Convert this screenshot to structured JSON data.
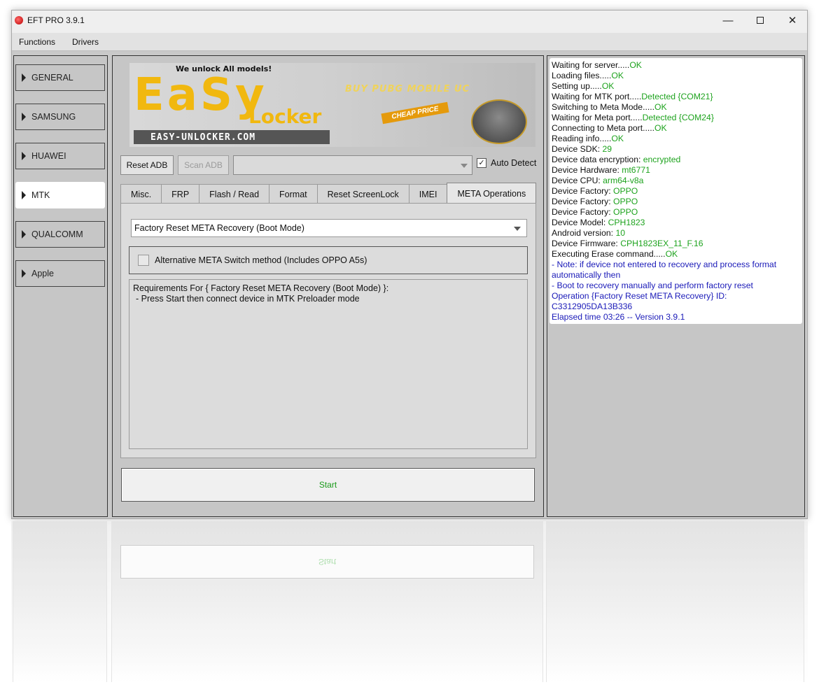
{
  "window": {
    "title": "EFT PRO 3.9.1",
    "controls": {
      "minimize": "—",
      "maximize": "",
      "close": "✕"
    }
  },
  "menu": {
    "items": [
      "Functions",
      "Drivers"
    ]
  },
  "sidebar": {
    "items": [
      {
        "label": "GENERAL",
        "active": false
      },
      {
        "label": "SAMSUNG",
        "active": false
      },
      {
        "label": "HUAWEI",
        "active": false
      },
      {
        "label": "MTK",
        "active": true
      },
      {
        "label": "QUALCOMM",
        "active": false
      },
      {
        "label": "Apple",
        "active": false
      }
    ]
  },
  "banner": {
    "tagline": "We unlock All models!",
    "logo_main": "EaSy",
    "logo_sub": "Locker",
    "site": "EASY-UNLOCKER.COM",
    "promo": "BUY PUBG MOBILE UC",
    "price_tag": "CHEAP PRICE",
    "badge_icon": "pubg-badge-icon"
  },
  "toolbar": {
    "reset_adb": "Reset ADB",
    "scan_adb": "Scan ADB",
    "port_select_value": "",
    "auto_detect_label": "Auto Detect",
    "auto_detect_checked": true
  },
  "tabs": [
    {
      "label": "Misc.",
      "active": false
    },
    {
      "label": "FRP",
      "active": false
    },
    {
      "label": "Flash / Read",
      "active": false
    },
    {
      "label": "Format",
      "active": false
    },
    {
      "label": "Reset ScreenLock",
      "active": false
    },
    {
      "label": "IMEI",
      "active": false
    },
    {
      "label": "META Operations",
      "active": true
    }
  ],
  "meta_ops": {
    "operation_value": "Factory Reset META Recovery (Boot Mode)",
    "alt_switch_label": "Alternative META Switch method (Includes OPPO A5s)",
    "alt_switch_checked": false,
    "requirements_line1": "Requirements For { Factory Reset META Recovery (Boot Mode) }:",
    "requirements_line2": "- Press Start then connect device in MTK Preloader mode"
  },
  "start_label": "Start",
  "log": [
    {
      "label": "Waiting for server.....",
      "value": "OK"
    },
    {
      "label": "Loading files.....",
      "value": "OK"
    },
    {
      "label": "Setting up.....",
      "value": "OK"
    },
    {
      "label": "Waiting for MTK port.....",
      "value": "Detected {COM21}"
    },
    {
      "label": "Switching to Meta Mode.....",
      "value": "OK"
    },
    {
      "label": "Waiting for Meta port.....",
      "value": "Detected {COM24}"
    },
    {
      "label": "Connecting to Meta port.....",
      "value": "OK"
    },
    {
      "label": "Reading info.....",
      "value": "OK"
    },
    {
      "label": "Device SDK: ",
      "value": "29"
    },
    {
      "label": "Device data encryption: ",
      "value": "encrypted"
    },
    {
      "label": "Device Hardware: ",
      "value": "mt6771"
    },
    {
      "label": "Device CPU: ",
      "value": "arm64-v8a"
    },
    {
      "label": "Device Factory: ",
      "value": "OPPO"
    },
    {
      "label": "Device Factory: ",
      "value": "OPPO"
    },
    {
      "label": "Device Factory: ",
      "value": "OPPO"
    },
    {
      "label": "Device Model: ",
      "value": "CPH1823"
    },
    {
      "label": "Android version: ",
      "value": "10"
    },
    {
      "label": "Device Firmware: ",
      "value": "CPH1823EX_11_F.16"
    },
    {
      "label": "Executing Erase command.....",
      "value": "OK"
    }
  ],
  "log_notes": [
    " - Note: if device not entered to recovery and process format automatically then",
    " - Boot to recovery manually and perform factory reset",
    "Operation {Factory Reset META Recovery} ID: C3312905DA13B336",
    "Elapsed time 03:26 -- Version 3.9.1"
  ],
  "colors": {
    "ok": "#1ea31e",
    "note": "#1a1ab8",
    "brand": "#f1b80f"
  }
}
